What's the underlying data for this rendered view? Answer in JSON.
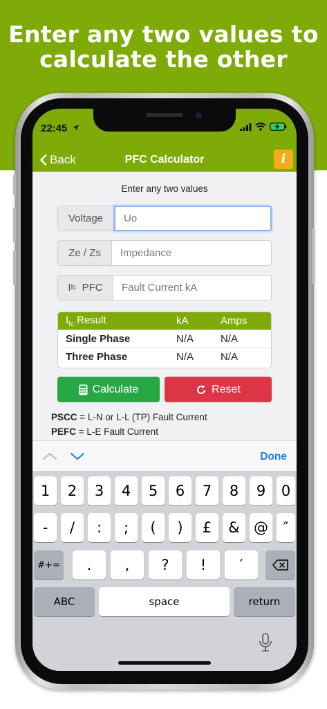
{
  "promo": {
    "headline_line1": "Enter any two values to",
    "headline_line2": "calculate the other",
    "band_color": "#7fab08"
  },
  "status_bar": {
    "time": "22:45",
    "icons": [
      "location-arrow-icon",
      "signal-icon",
      "wifi-icon",
      "battery-charging-icon"
    ]
  },
  "nav": {
    "back_label": "Back",
    "title": "PFC Calculator",
    "info_label": "i",
    "info_color": "#f3ad1c"
  },
  "form": {
    "instruction": "Enter any two values",
    "voltage": {
      "label": "Voltage",
      "placeholder": "Uo",
      "value": ""
    },
    "impedance": {
      "label": "Ze / Zs",
      "placeholder": "Impedance",
      "value": ""
    },
    "pfc": {
      "label_main": "I",
      "label_sub": "fc",
      "label_suffix": "PFC",
      "placeholder": "Fault Current kA",
      "value": ""
    }
  },
  "results": {
    "header": {
      "label_main": "I",
      "label_sub": "fc",
      "label_suffix": "Result",
      "col_ka": "kA",
      "col_amps": "Amps"
    },
    "rows": [
      {
        "name": "Single Phase",
        "ka": "N/A",
        "amps": "N/A"
      },
      {
        "name": "Three Phase",
        "ka": "N/A",
        "amps": "N/A"
      }
    ]
  },
  "actions": {
    "calculate_label": "Calculate",
    "reset_label": "Reset",
    "calculate_color": "#28a745",
    "reset_color": "#dc3545"
  },
  "legend": {
    "pscc_term": "PSCC",
    "pscc_text": " = L-N or L-L (TP) Fault Current",
    "pefc_term": "PEFC",
    "pefc_text": " = L-E Fault Current"
  },
  "keyboard": {
    "done_label": "Done",
    "row1": [
      "1",
      "2",
      "3",
      "4",
      "5",
      "6",
      "7",
      "8",
      "9",
      "0"
    ],
    "row2": [
      "-",
      "/",
      ":",
      ";",
      "(",
      ")",
      "£",
      "&",
      "@",
      "″"
    ],
    "row3_left": "#+=",
    "row3": [
      ".",
      ",",
      "?",
      "!",
      "′"
    ],
    "abc_label": "ABC",
    "space_label": "space",
    "return_label": "return"
  }
}
